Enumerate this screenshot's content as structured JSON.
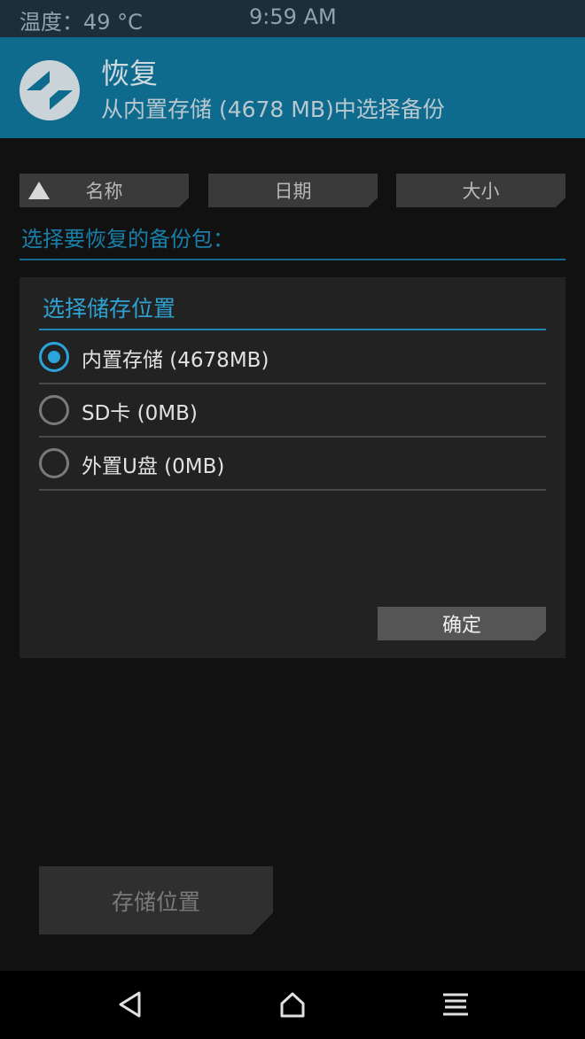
{
  "status_bar": {
    "temperature": "温度：49 °C",
    "time": "9:59 AM"
  },
  "header": {
    "title": "恢复",
    "subtitle": "从内置存储 (4678 MB)中选择备份",
    "logo_icon": "twrp-logo-icon"
  },
  "sort_buttons": [
    {
      "label": "名称",
      "active": true
    },
    {
      "label": "日期"
    },
    {
      "label": "大小"
    }
  ],
  "prompt": "选择要恢复的备份包：",
  "dialog": {
    "title": "选择储存位置",
    "options": [
      {
        "label": "内置存储 (4678MB)",
        "selected": true
      },
      {
        "label": "SD卡 (0MB)",
        "selected": false
      },
      {
        "label": "外置U盘 (0MB)",
        "selected": false
      }
    ],
    "ok_label": "确定"
  },
  "storage_button": "存储位置",
  "nav_bar": {
    "back_icon": "back-icon",
    "home_icon": "home-icon",
    "menu_icon": "menu-icon"
  },
  "colors": {
    "accent": "#2ba4db",
    "header_bg": "#0e6b8e"
  }
}
